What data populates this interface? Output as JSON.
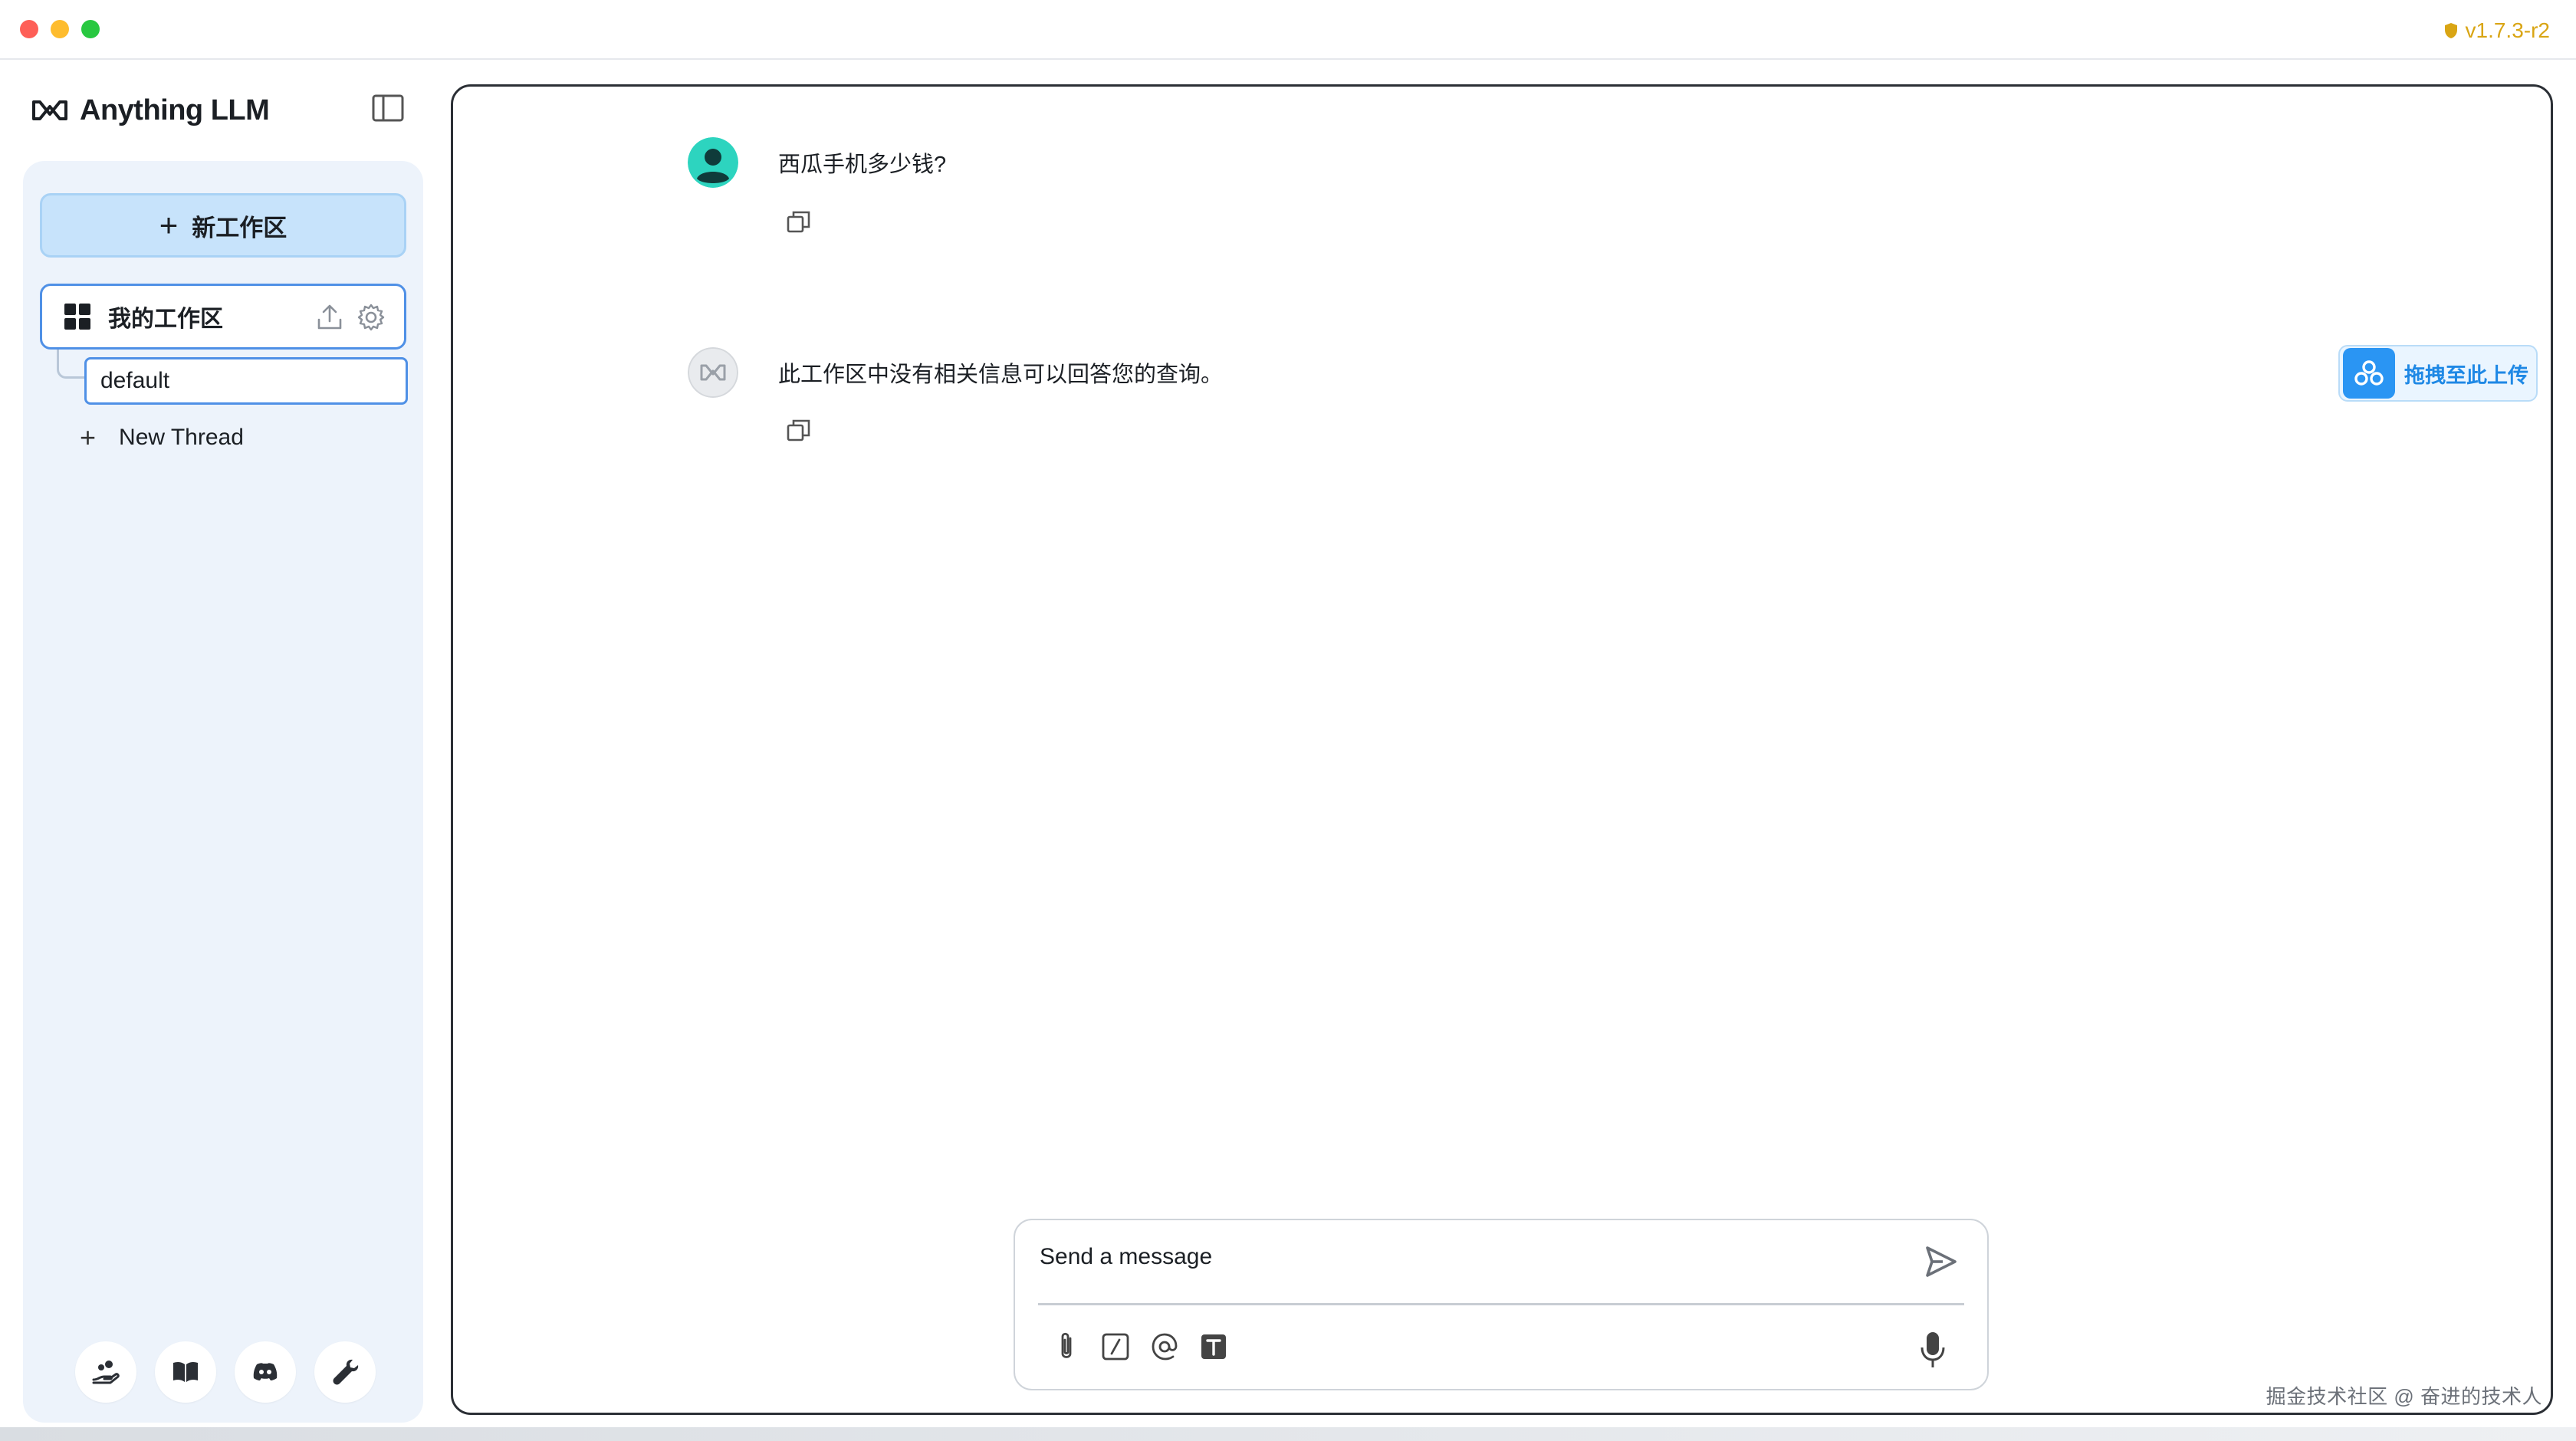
{
  "window": {
    "version": "v1.7.3-r2"
  },
  "sidebar": {
    "app_name": "Anything LLM",
    "new_workspace_label": "新工作区",
    "workspace": {
      "name": "我的工作区"
    },
    "threads": [
      {
        "label": "default"
      }
    ],
    "new_thread_label": "New Thread",
    "footer_icons": [
      "community-hub-icon",
      "docs-book-icon",
      "discord-icon",
      "settings-wrench-icon"
    ]
  },
  "chat": {
    "messages": [
      {
        "role": "user",
        "text": "西瓜手机多少钱?"
      },
      {
        "role": "assistant",
        "text": "此工作区中没有相关信息可以回答您的查询。"
      }
    ],
    "upload_label": "拖拽至此上传",
    "composer": {
      "placeholder": "Send a message",
      "tool_icons": [
        "paperclip-icon",
        "slash-command-icon",
        "at-mention-icon",
        "text-size-icon"
      ]
    }
  },
  "watermark": "掘金技术社区 @ 奋进的技术人",
  "colors": {
    "accent": "#4f90e6",
    "new_workspace_bg": "#c7e3fb",
    "sidebar_bg": "#edf3fb",
    "version": "#d9a514",
    "upload_button": "#2a95f3",
    "user_avatar": "#2dd4bf"
  }
}
